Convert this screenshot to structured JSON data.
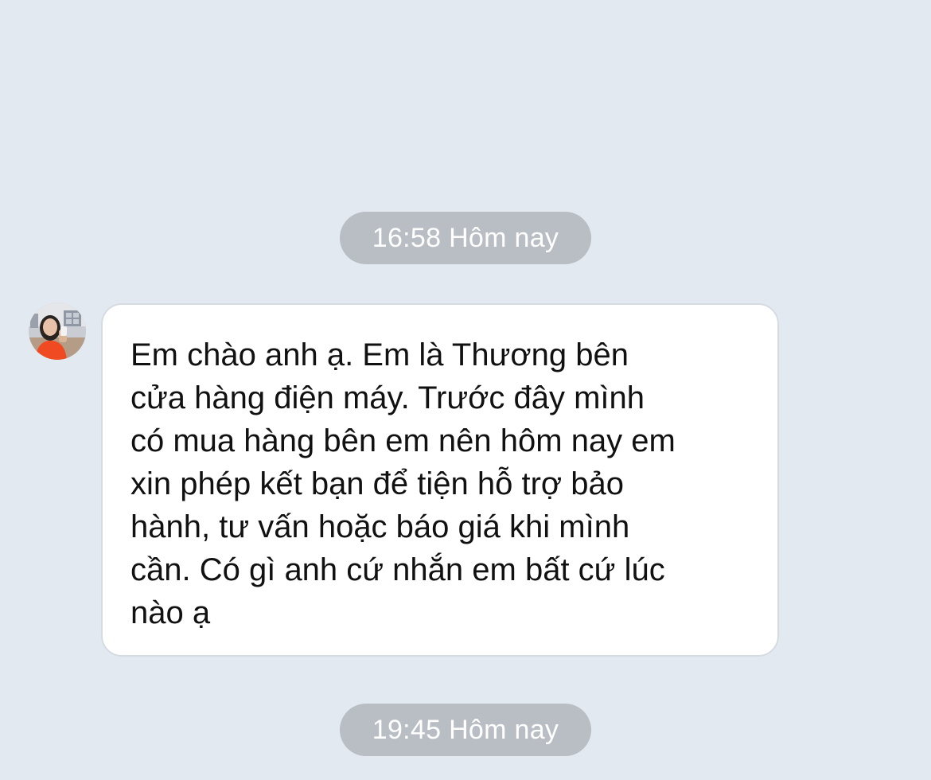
{
  "chat": {
    "timestamps": [
      "16:58 Hôm nay",
      "19:45 Hôm nay"
    ],
    "message": {
      "sender_avatar": "user-avatar-photo",
      "text": "Em chào anh ạ. Em là Thương  bên\ncửa hàng điện máy. Trước đây mình\ncó mua hàng bên em nên hôm nay em\nxin phép kết bạn để tiện hỗ trợ bảo\nhành, tư vấn hoặc báo giá khi mình\ncần. Có gì anh cứ nhắn em bất cứ lúc\nnào ạ"
    }
  },
  "colors": {
    "background": "#e3e9f1",
    "timestamp_pill": "#b9bdc4",
    "bubble": "#ffffff",
    "bubble_border": "#d6dbe2",
    "text": "#111111"
  }
}
